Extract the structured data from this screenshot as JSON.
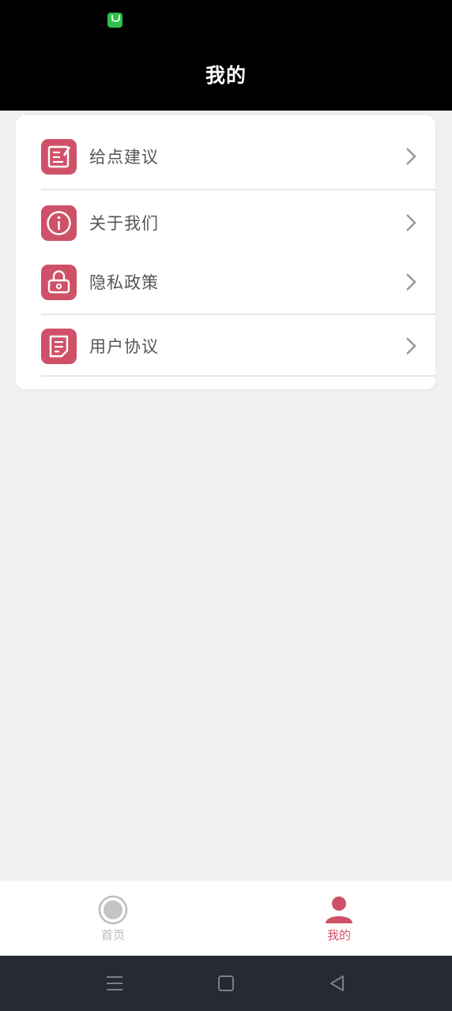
{
  "header": {
    "title": "我的"
  },
  "menu": {
    "items": [
      {
        "label": "给点建议",
        "icon": "feedback-icon"
      },
      {
        "label": "关于我们",
        "icon": "info-icon"
      },
      {
        "label": "隐私政策",
        "icon": "lock-icon"
      },
      {
        "label": "用户协议",
        "icon": "document-icon"
      }
    ]
  },
  "tabbar": {
    "tabs": [
      {
        "label": "首页",
        "icon": "home-circle-icon",
        "active": false
      },
      {
        "label": "我的",
        "icon": "user-icon",
        "active": true
      }
    ]
  },
  "colors": {
    "accent": "#cf5168",
    "header_bg": "#000000",
    "page_bg": "#f0f0f0",
    "inactive_tab": "#b9b9b9"
  }
}
